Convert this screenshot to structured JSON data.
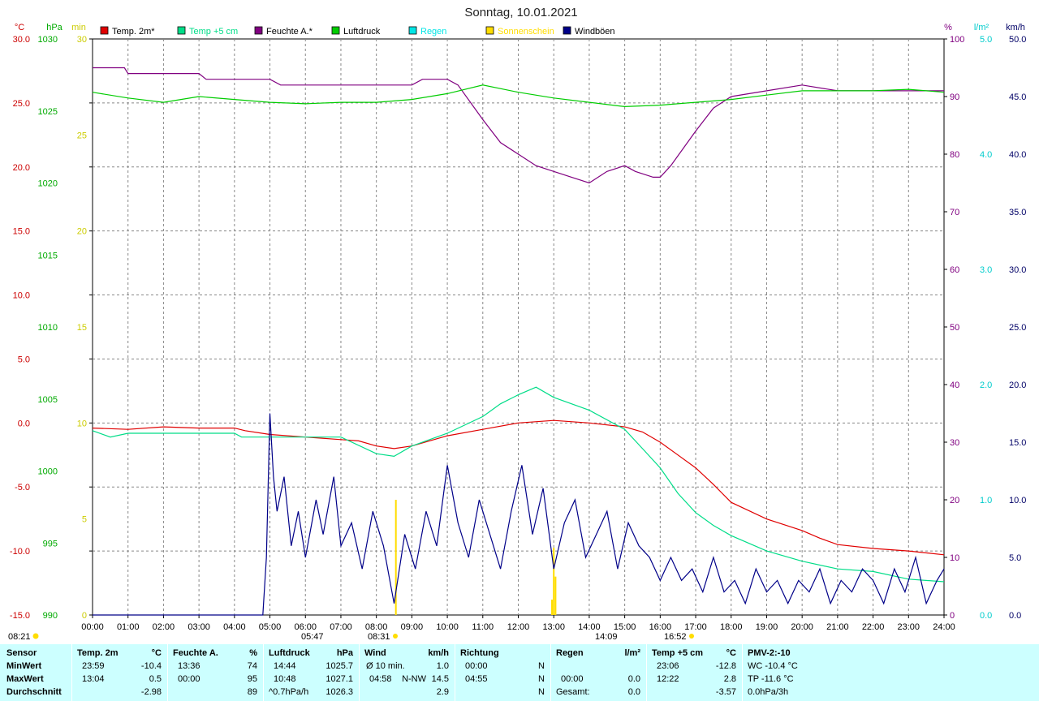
{
  "chart_data": {
    "type": "line",
    "title": "Sonntag, 10.01.2021",
    "legend": [
      {
        "label": "Temp. 2m*",
        "color": "#e00000"
      },
      {
        "label": "Temp +5 cm",
        "color": "#00dd88"
      },
      {
        "label": "Feuchte A.*",
        "color": "#800080"
      },
      {
        "label": "Luftdruck",
        "color": "#00cc00"
      },
      {
        "label": "Regen",
        "color": "#00e5e5"
      },
      {
        "label": "Sonnenschein",
        "color": "#ffdd00"
      },
      {
        "label": "Windböen",
        "color": "#000088"
      }
    ],
    "axes": {
      "temp": {
        "unit": "°C",
        "min": -15,
        "max": 30,
        "color": "#cc0000",
        "ticks": [
          "30.0",
          "25.0",
          "20.0",
          "15.0",
          "10.0",
          "5.0",
          "0.0",
          "-5.0",
          "-10.0",
          "-15.0"
        ]
      },
      "pressure": {
        "unit": "hPa",
        "min": 990,
        "max": 1030,
        "color": "#00aa00",
        "ticks": [
          "1030",
          "1025",
          "1020",
          "1015",
          "1010",
          "1005",
          "1000",
          "995",
          "990"
        ]
      },
      "sun": {
        "unit": "min",
        "min": 0,
        "max": 30,
        "color": "#cccc00",
        "ticks": [
          "30",
          "25",
          "20",
          "15",
          "10",
          "5",
          "0"
        ]
      },
      "humidity": {
        "unit": "%",
        "min": 0,
        "max": 100,
        "color": "#800080",
        "ticks": [
          "100",
          "90",
          "80",
          "70",
          "60",
          "50",
          "40",
          "30",
          "20",
          "10",
          "0"
        ]
      },
      "rain": {
        "unit": "l/m²",
        "min": 0,
        "max": 5,
        "color": "#00cccc",
        "ticks": [
          "5.0",
          "4.0",
          "3.0",
          "2.0",
          "1.0",
          "0.0"
        ]
      },
      "wind": {
        "unit": "km/h",
        "min": 0,
        "max": 50,
        "color": "#000066",
        "ticks": [
          "50.0",
          "45.0",
          "40.0",
          "35.0",
          "30.0",
          "25.0",
          "20.0",
          "15.0",
          "10.0",
          "5.0",
          "0.0"
        ]
      }
    },
    "x_ticks": [
      "00:00",
      "01:00",
      "02:00",
      "03:00",
      "04:00",
      "05:00",
      "06:00",
      "07:00",
      "08:00",
      "09:00",
      "10:00",
      "11:00",
      "12:00",
      "13:00",
      "14:00",
      "15:00",
      "16:00",
      "17:00",
      "18:00",
      "19:00",
      "20:00",
      "21:00",
      "22:00",
      "23:00",
      "24:00"
    ],
    "series": [
      {
        "name": "Temp. 2m*",
        "axis": "temp",
        "color": "#e00000",
        "x": [
          0,
          1,
          2,
          3,
          4,
          4.3,
          5,
          6,
          7,
          7.5,
          8,
          8.5,
          9,
          10,
          11,
          12,
          13,
          14,
          15,
          15.5,
          16,
          16.5,
          17,
          17.5,
          18,
          19,
          20,
          20.5,
          21,
          22,
          23,
          24
        ],
        "y": [
          -0.4,
          -0.5,
          -0.3,
          -0.4,
          -0.4,
          -0.6,
          -0.9,
          -1.1,
          -1.3,
          -1.4,
          -1.8,
          -2.0,
          -1.8,
          -1.0,
          -0.5,
          0.0,
          0.2,
          0.0,
          -0.3,
          -0.7,
          -1.5,
          -2.5,
          -3.5,
          -4.8,
          -6.2,
          -7.5,
          -8.4,
          -9.0,
          -9.5,
          -9.8,
          -10.0,
          -10.3
        ]
      },
      {
        "name": "Temp +5 cm",
        "axis": "temp",
        "color": "#00dd88",
        "x": [
          0,
          0.5,
          1,
          2,
          3,
          4,
          4.2,
          5,
          6,
          7,
          8,
          8.5,
          9,
          10,
          11,
          11.5,
          12,
          12.5,
          13,
          14,
          15,
          15.5,
          16,
          16.5,
          17,
          17.5,
          18,
          19,
          20,
          21,
          22,
          23,
          24
        ],
        "y": [
          -0.6,
          -1.1,
          -0.8,
          -0.8,
          -0.8,
          -0.8,
          -1.1,
          -1.1,
          -1.1,
          -1.1,
          -2.4,
          -2.6,
          -1.8,
          -0.8,
          0.5,
          1.5,
          2.2,
          2.8,
          2.0,
          1.0,
          -0.5,
          -2.0,
          -3.5,
          -5.5,
          -7.0,
          -8.0,
          -8.8,
          -10.0,
          -10.8,
          -11.4,
          -11.6,
          -12.2,
          -12.4
        ]
      },
      {
        "name": "Feuchte A.*",
        "axis": "humidity",
        "color": "#800080",
        "x": [
          0,
          0.9,
          1,
          2,
          3,
          3.2,
          4,
          5,
          5.3,
          6,
          7,
          7.5,
          8,
          9,
          9.3,
          10,
          10.3,
          11,
          11.5,
          12,
          12.5,
          13,
          13.5,
          14,
          14.5,
          15,
          15.3,
          15.8,
          16,
          16.3,
          17,
          17.5,
          18,
          19,
          20,
          21,
          22,
          23,
          24
        ],
        "y": [
          95,
          95,
          94,
          94,
          94,
          93,
          93,
          93,
          92,
          92,
          92,
          92,
          92,
          92,
          93,
          93,
          92,
          86,
          82,
          80,
          78,
          77,
          76,
          75,
          77,
          78,
          77,
          76,
          76,
          78,
          84,
          88,
          90,
          91,
          92,
          91,
          91,
          91,
          91
        ]
      },
      {
        "name": "Luftdruck",
        "axis": "pressure",
        "color": "#00cc00",
        "x": [
          0,
          1,
          2,
          3,
          4,
          5,
          6,
          7,
          8,
          9,
          10,
          11,
          12,
          13,
          14,
          15,
          16,
          17,
          18,
          19,
          20,
          21,
          22,
          23,
          24
        ],
        "y": [
          1026.3,
          1025.9,
          1025.6,
          1026.0,
          1025.8,
          1025.6,
          1025.5,
          1025.6,
          1025.6,
          1025.8,
          1026.2,
          1026.8,
          1026.3,
          1025.9,
          1025.6,
          1025.3,
          1025.4,
          1025.6,
          1025.8,
          1026.1,
          1026.4,
          1026.4,
          1026.4,
          1026.5,
          1026.3
        ]
      },
      {
        "name": "Windböen",
        "axis": "wind",
        "color": "#000088",
        "x": [
          0,
          4.8,
          4.9,
          5.0,
          5.1,
          5.2,
          5.4,
          5.6,
          5.8,
          6.0,
          6.3,
          6.5,
          6.8,
          7.0,
          7.3,
          7.6,
          7.9,
          8.2,
          8.5,
          8.8,
          9.1,
          9.4,
          9.7,
          10.0,
          10.3,
          10.6,
          10.9,
          11.2,
          11.5,
          11.8,
          12.1,
          12.4,
          12.7,
          13.0,
          13.3,
          13.6,
          13.9,
          14.2,
          14.5,
          14.8,
          15.1,
          15.4,
          15.7,
          16.0,
          16.3,
          16.6,
          16.9,
          17.2,
          17.5,
          17.8,
          18.1,
          18.4,
          18.7,
          19.0,
          19.3,
          19.6,
          19.9,
          20.2,
          20.5,
          20.8,
          21.1,
          21.4,
          21.7,
          22.0,
          22.3,
          22.6,
          22.9,
          23.2,
          23.5,
          23.8,
          24
        ],
        "y": [
          0,
          0,
          5,
          17.5,
          12,
          9,
          12,
          6,
          9,
          5,
          10,
          7,
          12,
          6,
          8,
          4,
          9,
          6,
          1,
          7,
          4,
          9,
          6,
          13,
          8,
          5,
          10,
          7,
          4,
          9,
          13,
          7,
          11,
          4,
          8,
          10,
          5,
          7,
          9,
          4,
          8,
          6,
          5,
          3,
          5,
          3,
          4,
          2,
          5,
          2,
          3,
          1,
          4,
          2,
          3,
          1,
          3,
          2,
          4,
          1,
          3,
          2,
          4,
          3,
          1,
          4,
          2,
          5,
          1,
          3,
          4
        ]
      }
    ],
    "markers": [
      {
        "label": "08:21",
        "color": "#ffdd00"
      },
      {
        "label": "05:47"
      },
      {
        "label": "08:31"
      },
      {
        "label": "14:09"
      },
      {
        "label": "16:52"
      }
    ]
  },
  "stats": {
    "sensor": {
      "title": "Sensor",
      "rows": [
        "MinWert",
        "MaxWert",
        "Durchschnitt"
      ]
    },
    "temp2m": {
      "title": "Temp. 2m",
      "unit": "°C",
      "min_time": "23:59",
      "min": "-10.4",
      "max_time": "13:04",
      "max": "0.5",
      "avg": "-2.98"
    },
    "humidity": {
      "title": "Feuchte A.",
      "unit": "%",
      "min_time": "13:36",
      "min": "74",
      "max_time": "00:00",
      "max": "95",
      "avg": "89"
    },
    "pressure": {
      "title": "Luftdruck",
      "unit": "hPa",
      "min_time": "14:44",
      "min": "1025.7",
      "max_time": "10:48",
      "max": "1027.1",
      "avg_label": "^0.7hPa/h",
      "avg": "1026.3"
    },
    "wind": {
      "title": "Wind",
      "unit": "km/h",
      "r1_label": "Ø 10 min.",
      "r1_val": "1.0",
      "r2_time": "04:58",
      "r2_dir": "N-NW",
      "r2_val": "14.5",
      "avg": "2.9"
    },
    "direction": {
      "title": "Richtung",
      "r1_time": "00:00",
      "r1_dir": "N",
      "r2_time": "04:55",
      "r2_dir": "N",
      "r3_dir": "N"
    },
    "rain": {
      "title": "Regen",
      "unit": "l/m²",
      "r2_time": "00:00",
      "r2_val": "0.0",
      "r3_label": "Gesamt:",
      "r3_val": "0.0"
    },
    "temp5cm": {
      "title": "Temp +5 cm",
      "unit": "°C",
      "min_time": "23:06",
      "min": "-12.8",
      "max_time": "12:22",
      "max": "2.8",
      "avg": "-3.57"
    },
    "pmv": {
      "title": "PMV-2:-10",
      "r1": "WC -10.4 °C",
      "r2": "TP -11.6 °C",
      "r3": "0.0hPa/3h"
    }
  }
}
